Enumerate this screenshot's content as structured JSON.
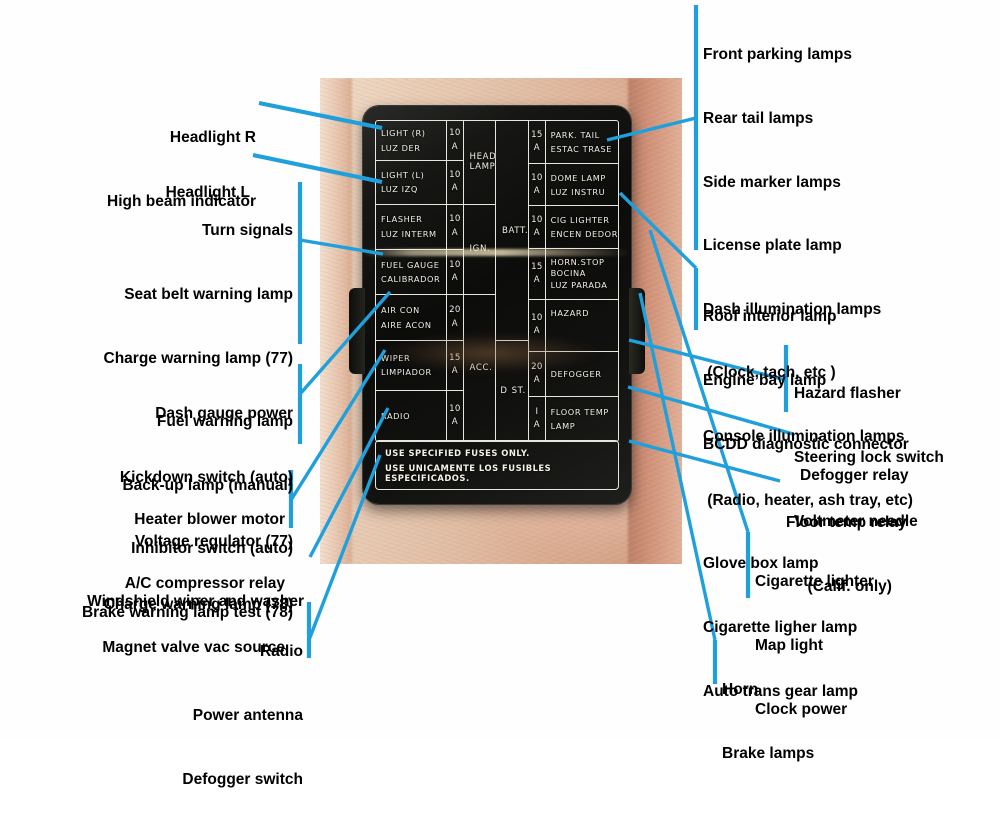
{
  "image": {
    "kind": "annotated-photo",
    "subject": "Datsun 280Z fuse box lid legend with callout annotations",
    "accent_color": "#1fa0dc",
    "text_color": "#000000",
    "background_color": "#ffffff"
  },
  "fusebox": {
    "notice_line1": "USE SPECIFIED FUSES ONLY.",
    "notice_line2": "USE UNICAMENTE LOS FUSIBLES ESPECIFICADOS.",
    "left_column": [
      {
        "en": "LIGHT (R)",
        "es": "LUZ DER",
        "amp_num": "10",
        "amp_unit": "A"
      },
      {
        "en": "LIGHT (L)",
        "es": "LUZ IZQ",
        "amp_num": "10",
        "amp_unit": "A"
      },
      {
        "en": "FLASHER",
        "es": "LUZ INTERM",
        "amp_num": "10",
        "amp_unit": "A"
      },
      {
        "en": "FUEL GAUGE",
        "es": "CALIBRADOR",
        "amp_num": "10",
        "amp_unit": "A"
      },
      {
        "en": "AIR CON",
        "es": "AIRE ACON",
        "amp_num": "20",
        "amp_unit": "A"
      },
      {
        "en": "WIPER",
        "es": "LIMPIADOR",
        "amp_num": "15",
        "amp_unit": "A"
      },
      {
        "en": "RADIO",
        "es": "",
        "amp_num": "10",
        "amp_unit": "A"
      }
    ],
    "right_column": [
      {
        "en": "PARK. TAIL",
        "es": "ESTAC TRASE",
        "es2": "",
        "amp_num": "15",
        "amp_unit": "A"
      },
      {
        "en": "DOME LAMP",
        "es": "LUZ INSTRU",
        "es2": "",
        "amp_num": "10",
        "amp_unit": "A"
      },
      {
        "en": "CIG LIGHTER",
        "es": "ENCEN DEDOR",
        "es2": "",
        "amp_num": "10",
        "amp_unit": "A"
      },
      {
        "en": "HORN.STOP",
        "es": "BOCINA",
        "es2": "LUZ PARADA",
        "amp_num": "15",
        "amp_unit": "A"
      },
      {
        "en": "HAZARD",
        "es": "",
        "es2": "",
        "amp_num": "10",
        "amp_unit": "A"
      },
      {
        "en": "DEFOGGER",
        "es": "",
        "es2": "",
        "amp_num": "20",
        "amp_unit": "A"
      },
      {
        "en": "FLOOR TEMP",
        "es": "LAMP",
        "es2": "",
        "amp_num": "I",
        "amp_unit": "A"
      }
    ],
    "bus_labels_inner": [
      "HEAD\nLAMP",
      "IGN.",
      "ACC."
    ],
    "bus_labels_outer": [
      "BATT.",
      "D",
      "ST."
    ]
  },
  "callouts_left": [
    {
      "id": "headlight-r",
      "lines": [
        "Headlight R",
        "High beam indicator"
      ]
    },
    {
      "id": "headlight-l",
      "lines": [
        "Headlight L"
      ]
    },
    {
      "id": "turn-signals-group",
      "lines": [
        "Turn signals",
        "Seat belt warning lamp",
        "Charge warning lamp (77)",
        "Fuel warning lamp",
        "Back-up lamp (manual)",
        "Inhibitor switch (auto)",
        "Brake warning lamp test (78)"
      ]
    },
    {
      "id": "dash-gauge-group",
      "lines": [
        "Dash gauge power",
        "Kickdown switch (auto)",
        "Voltage regulator (77)",
        "Charge warning lamp (78)"
      ]
    },
    {
      "id": "heater-blower-group",
      "lines": [
        "Heater blower motor",
        "A/C compressor relay",
        "Magnet valve vac source"
      ]
    },
    {
      "id": "wiper",
      "lines": [
        "Windshield wiper and washer"
      ]
    },
    {
      "id": "radio-group",
      "lines": [
        "Radio",
        "Power antenna",
        "Defogger switch"
      ]
    }
  ],
  "callouts_right": [
    {
      "id": "park-tail-group",
      "lines": [
        "Front parking lamps",
        "Rear tail lamps",
        "Side marker lamps",
        "License plate lamp",
        "Dash illumination lamps",
        " (Clock, tach, etc )",
        "Console illumination lamps",
        " (Radio, heater, ash tray, etc)",
        "Glove box lamp",
        "Cigarette ligher lamp",
        "Auto trans gear lamp"
      ]
    },
    {
      "id": "dome-lamp-group",
      "lines": [
        "Roof interior lamp",
        "Engine bay lamp",
        "BCDD diagnostic connector"
      ]
    },
    {
      "id": "hazard-group",
      "lines": [
        "Hazard flasher",
        "Steering lock switch",
        "Voltmeter needle"
      ]
    },
    {
      "id": "defogger-relay",
      "lines": [
        "Defogger relay"
      ]
    },
    {
      "id": "floor-temp",
      "lines": [
        "Floor temp relay",
        "     (Calif. only)"
      ]
    },
    {
      "id": "cig-lighter-group",
      "lines": [
        "Cigarette lighter",
        "Map light",
        "Clock power"
      ]
    },
    {
      "id": "horn-group",
      "lines": [
        "Horn",
        "Brake lamps"
      ]
    }
  ]
}
